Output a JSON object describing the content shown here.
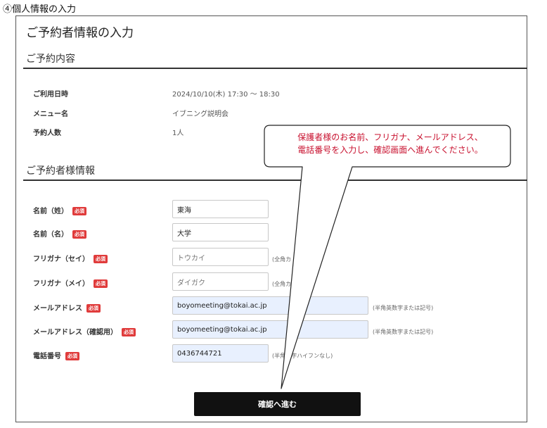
{
  "caption": "④個人情報の入力",
  "form": {
    "title": "ご予約者情報の入力",
    "reservation_section": "ご予約内容",
    "reservation": [
      {
        "label": "ご利用日時",
        "value": "2024/10/10(木) 17:30 ～ 18:30"
      },
      {
        "label": "メニュー名",
        "value": "イブニング説明会"
      },
      {
        "label": "予約人数",
        "value": "1人"
      }
    ],
    "booker_section": "ご予約者様情報",
    "required_badge": "必須",
    "fields": [
      {
        "label": "名前（姓）",
        "value": "東海",
        "hint": ""
      },
      {
        "label": "名前（名）",
        "value": "大学",
        "hint": ""
      },
      {
        "label": "フリガナ（セイ）",
        "value": "トウカイ",
        "hint": "(全角カ"
      },
      {
        "label": "フリガナ（メイ）",
        "value": "ダイガク",
        "hint": "(全角カ"
      },
      {
        "label": "メールアドレス",
        "value": "boyomeeting@tokai.ac.jp",
        "hint": "(半角英数字または記号)"
      },
      {
        "label": "メールアドレス（確認用）",
        "value": "boyomeeting@tokai.ac.jp",
        "hint": "(半角英数字または記号)"
      },
      {
        "label": "電話番号",
        "value": "0436744721",
        "hint": "(半角数字ハイフンなし)"
      }
    ],
    "confirm_button": "確認へ進む"
  },
  "callout": {
    "line1": "保護者様のお名前、フリガナ、メールアドレス、",
    "line2": "電話番号を入力し、確認画面へ進んでください。"
  },
  "colors": {
    "required_badge": "#e03b3b",
    "callout_text": "#c8102e",
    "autofill_field": "#e8f0fe",
    "button": "#111111"
  }
}
